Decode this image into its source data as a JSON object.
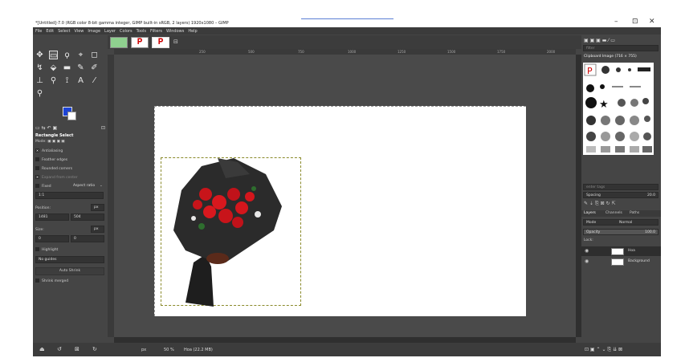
{
  "window": {
    "title": "*[Untitled]-7.0 (RGB color 8-bit gamma integer, GIMP built-in sRGB, 2 layers) 1920x1080 – GIMP",
    "minimize": "–",
    "maximize": "⊡",
    "close": "✕"
  },
  "menubar": [
    "File",
    "Edit",
    "Select",
    "View",
    "Image",
    "Layer",
    "Colors",
    "Tools",
    "Filters",
    "Windows",
    "Help"
  ],
  "tool_options": {
    "title": "Rectangle Select",
    "mode_label": "Mode:",
    "antialiasing": "Antialiasing",
    "feather_edges": "Feather edges",
    "rounded_corners": "Rounded corners",
    "expand_from_center": "Expand from center",
    "fixed": "Fixed",
    "aspect_ratio": "Aspect ratio",
    "ratio_value": "1:1",
    "position_label": "Position:",
    "position_unit": "px",
    "position_x": "1481",
    "position_y": "504",
    "size_label": "Size:",
    "size_unit": "px",
    "size_w": "0",
    "size_h": "0",
    "highlight": "Highlight",
    "guides": "No guides",
    "auto_shrink": "Auto Shrink",
    "shrink_merged": "Shrink merged"
  },
  "ruler_marks": [
    "250",
    "500",
    "750",
    "1000",
    "1250",
    "1500",
    "1750",
    "2000"
  ],
  "statusbar": {
    "unit": "px",
    "zoom": "50 %",
    "layer_info": "Hoa (22.2 MB)"
  },
  "dock": {
    "filter_placeholder": "filter",
    "brush_name": "Clipboard Image (716 × 755)",
    "tag_placeholder": "enter tags",
    "spacing_label": "Spacing",
    "spacing_value": "20.0",
    "tabs": [
      "Layers",
      "Channels",
      "Paths"
    ],
    "mode_label": "Mode",
    "mode_value": "Normal",
    "opacity_label": "Opacity",
    "opacity_value": "100.0",
    "lock_label": "Lock:",
    "layers": [
      {
        "name": "Hoa"
      },
      {
        "name": "Background"
      }
    ]
  }
}
